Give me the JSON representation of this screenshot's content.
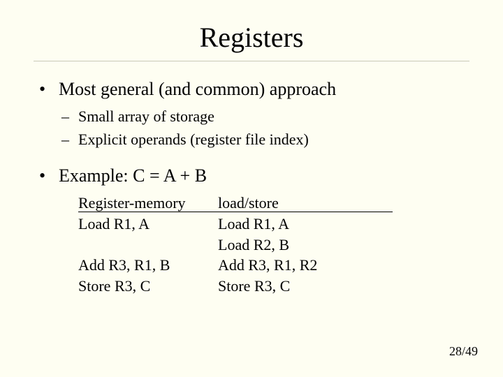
{
  "title": "Registers",
  "bullets": {
    "b1": "Most general (and common) approach",
    "subs": {
      "s1": "Small array of storage",
      "s2": "Explicit operands (register file index)"
    },
    "b2": "Example: C = A + B"
  },
  "table": {
    "header_left": "Register-memory",
    "header_right": "load/store",
    "rows": [
      {
        "left": "Load R1, A",
        "right": "Load R1, A"
      },
      {
        "left": "",
        "right": "Load R2, B"
      },
      {
        "left": "Add  R3, R1, B",
        "right": "Add  R3, R1, R2"
      },
      {
        "left": "Store R3, C",
        "right": "Store R3, C"
      }
    ]
  },
  "page_number": "28/49"
}
